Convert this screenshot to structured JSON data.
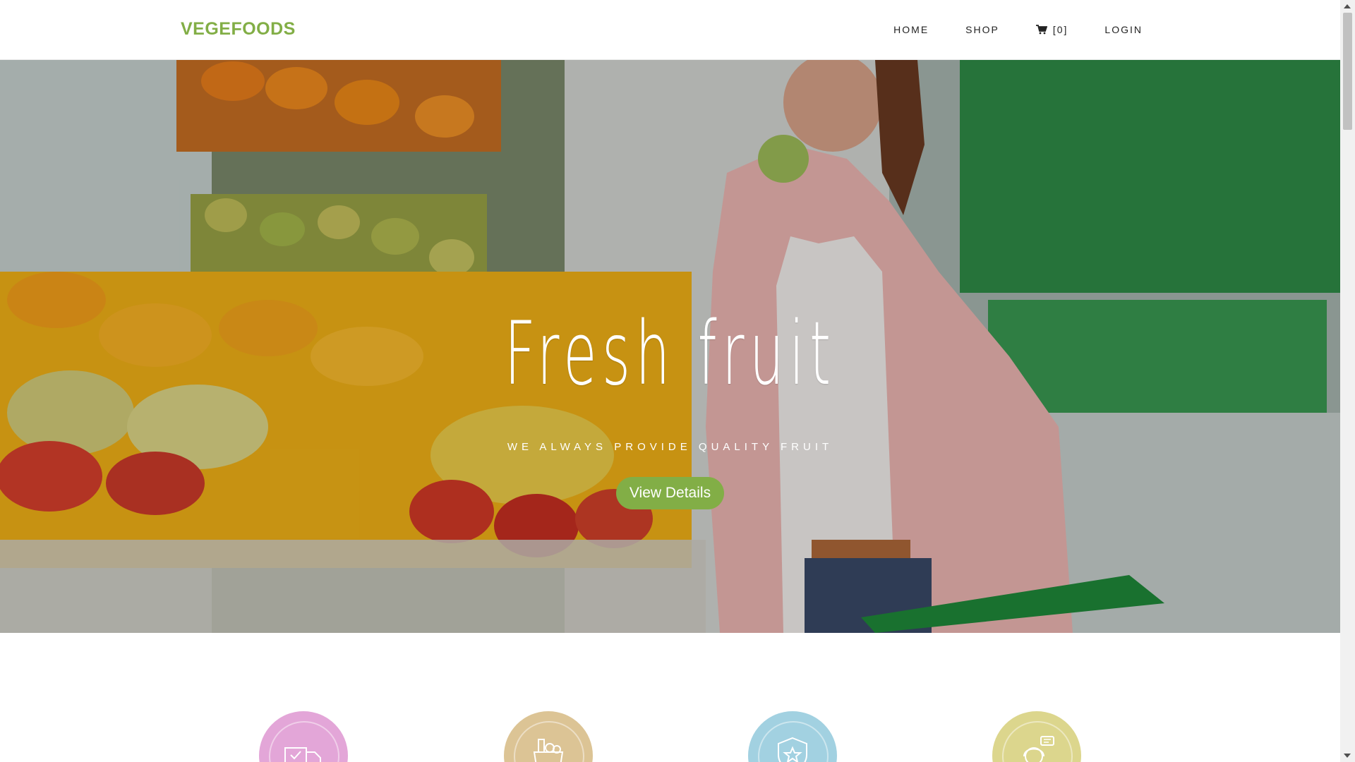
{
  "brand": {
    "name": "VEGEFOODS",
    "color": "#82ae46"
  },
  "nav": {
    "items": [
      {
        "label": "HOME"
      },
      {
        "label": "SHOP"
      },
      {
        "label": "[0]",
        "icon": "cart-icon"
      },
      {
        "label": "LOGIN"
      }
    ]
  },
  "hero": {
    "title": "Fresh fruit",
    "subtitle": "WE ALWAYS PROVIDE QUALITY FRUIT",
    "button_label": "View Details"
  },
  "features": [
    {
      "icon": "delivery-truck-icon",
      "color": "#e3a6d8"
    },
    {
      "icon": "grocery-bag-icon",
      "color": "#dcc495"
    },
    {
      "icon": "quality-badge-icon",
      "color": "#a2d1e1"
    },
    {
      "icon": "customer-support-icon",
      "color": "#dcd68d"
    }
  ]
}
